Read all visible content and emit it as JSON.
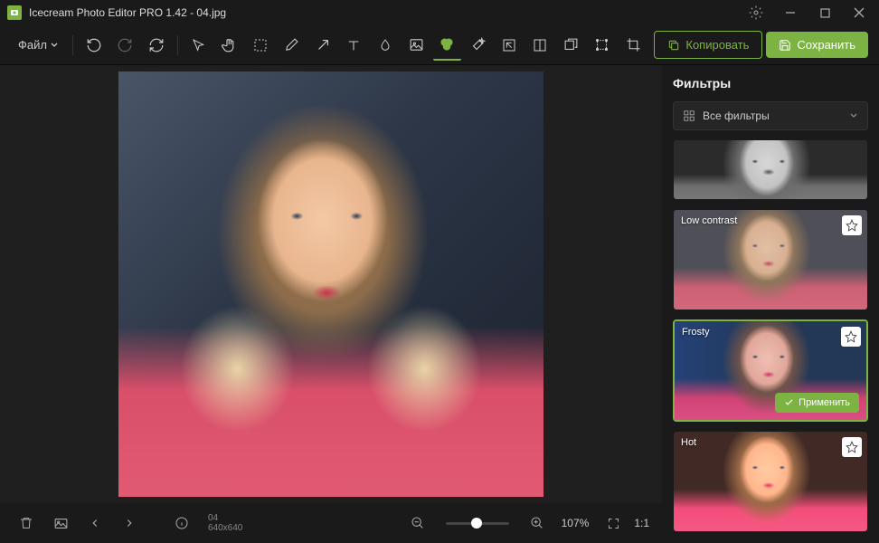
{
  "titlebar": {
    "title": "Icecream Photo Editor PRO 1.42 - 04.jpg"
  },
  "toolbar": {
    "file_label": "Файл",
    "copy_label": "Копировать",
    "save_label": "Сохранить"
  },
  "statusbar": {
    "filename": "04",
    "dimensions": "640x640",
    "zoom_percent": "107%",
    "ratio": "1:1"
  },
  "sidebar": {
    "title": "Фильтры",
    "dropdown_label": "Все фильтры",
    "filters": [
      {
        "name": ""
      },
      {
        "name": "Low contrast"
      },
      {
        "name": "Frosty",
        "selected": true,
        "apply_label": "Применить"
      },
      {
        "name": "Hot"
      }
    ]
  }
}
